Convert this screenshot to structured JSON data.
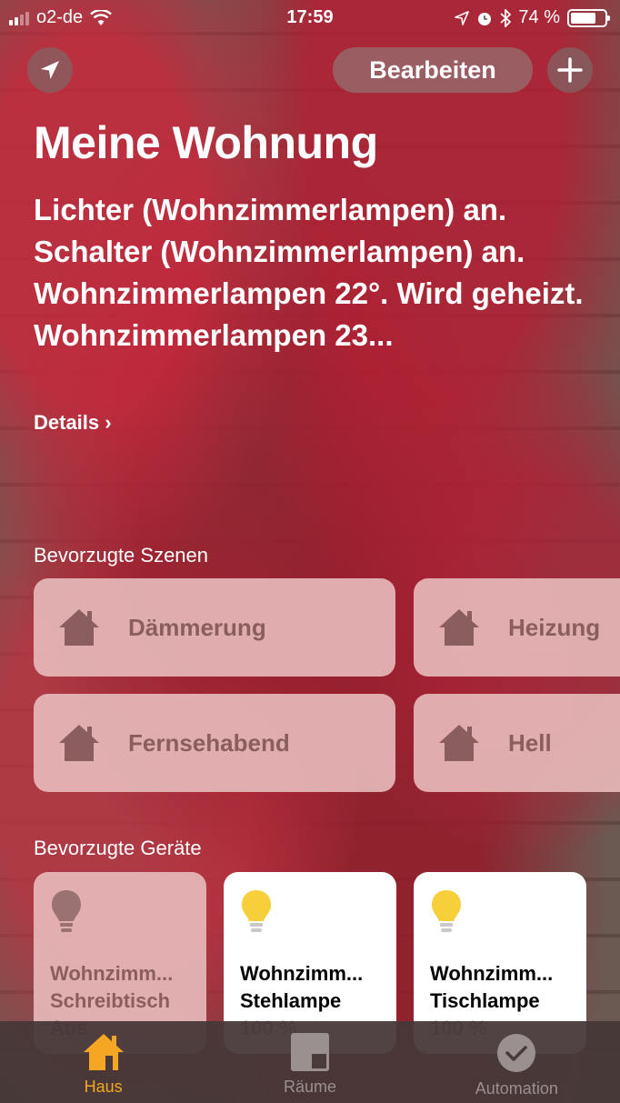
{
  "status_bar": {
    "carrier": "o2-de",
    "time": "17:59",
    "battery": "74 %",
    "battery_level": 0.74
  },
  "header": {
    "edit_label": "Bearbeiten",
    "title": "Meine Wohnung",
    "summary_lines": [
      "Lichter (Wohnzimmerlampen) an.",
      "Schalter (Wohnzimmerlampen) an.",
      "Wohnzimmerlampen 22°. Wird geheizt. Wohnzimmerlampen 23..."
    ],
    "details_label": "Details"
  },
  "scenes": {
    "label": "Bevorzugte Szenen",
    "items": [
      {
        "name": "Dämmerung"
      },
      {
        "name": "Heizung"
      },
      {
        "name": "Fernsehabend"
      },
      {
        "name": "Hell"
      }
    ]
  },
  "devices": {
    "label": "Bevorzugte Geräte",
    "items": [
      {
        "room": "Wohnzimm...",
        "name": "Schreibtisch",
        "state": "Aus",
        "on": false
      },
      {
        "room": "Wohnzimm...",
        "name": "Stehlampe",
        "state": "100 %",
        "on": true
      },
      {
        "room": "Wohnzimm...",
        "name": "Tischlampe",
        "state": "100 %",
        "on": true
      }
    ]
  },
  "tab_bar": {
    "tabs": [
      {
        "label": "Haus",
        "active": true
      },
      {
        "label": "Räume",
        "active": false
      },
      {
        "label": "Automation",
        "active": false
      }
    ]
  },
  "colors": {
    "accent": "#f5a623",
    "bulb_on": "#f6cf3a",
    "tile_off": "#e6b9b9"
  }
}
